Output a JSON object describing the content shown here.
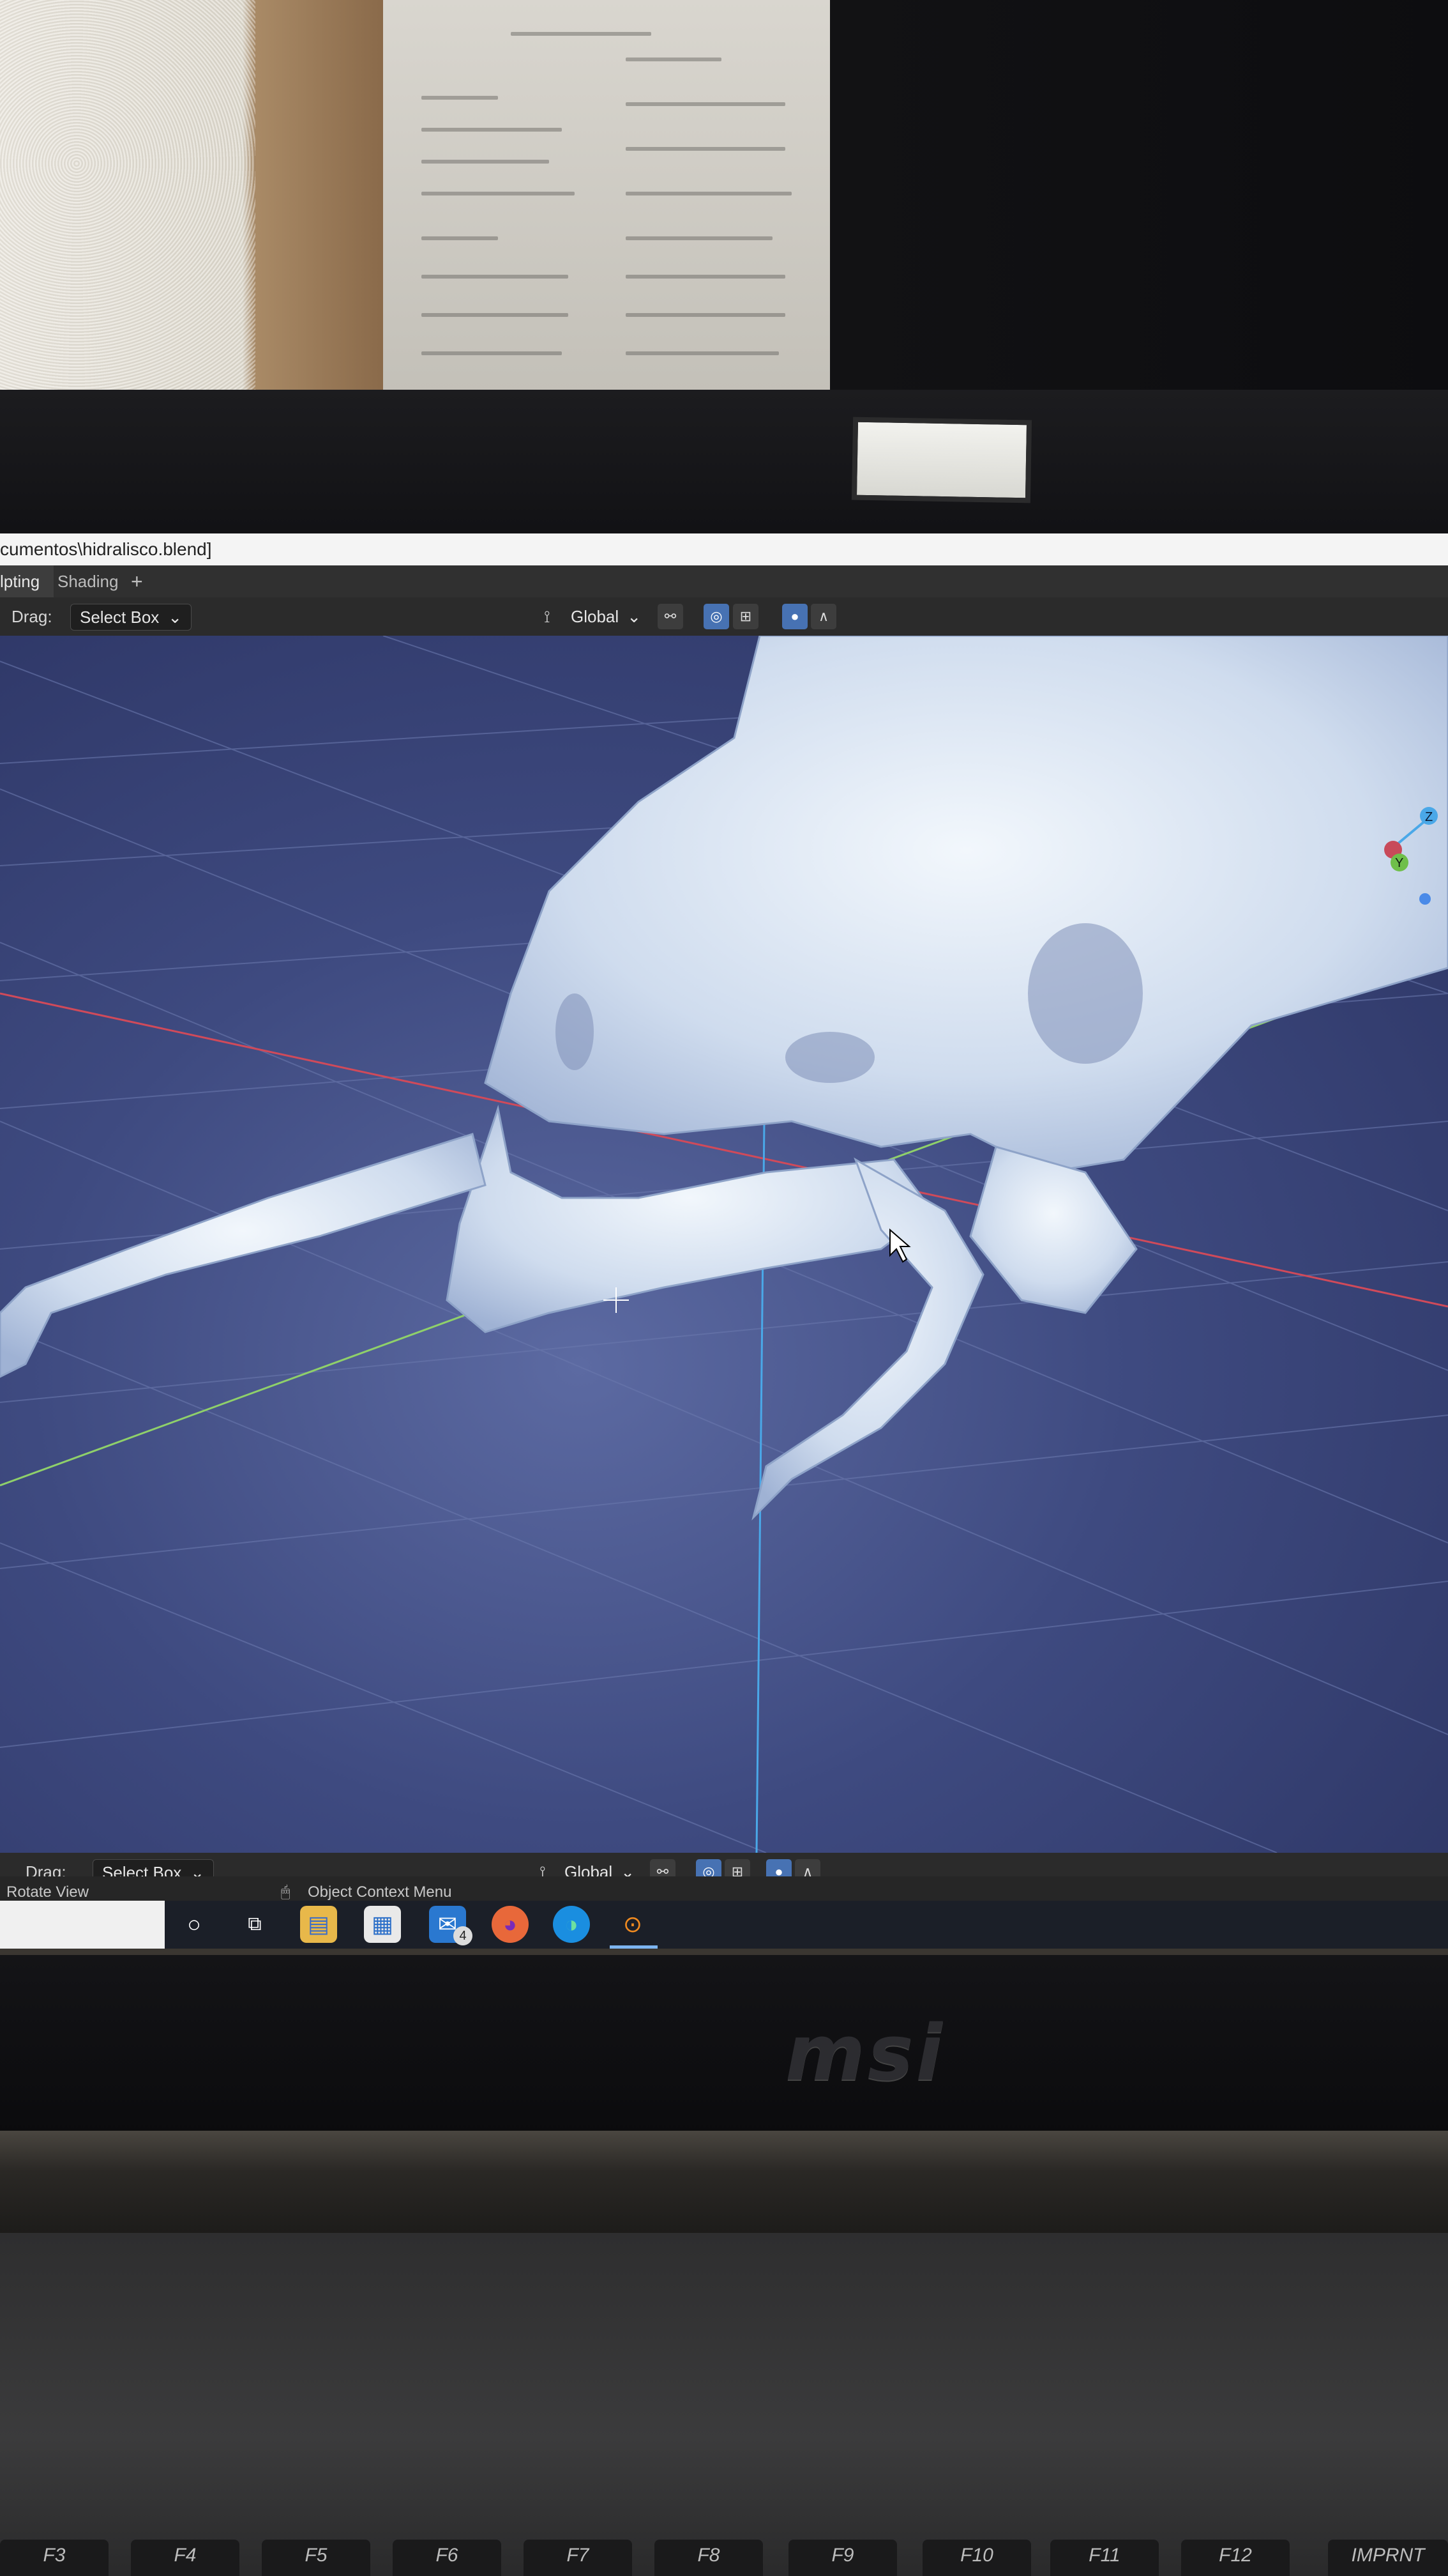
{
  "window": {
    "title": "cumentos\\hidralisco.blend]"
  },
  "workspaces": {
    "tabs": [
      {
        "label": "lpting"
      },
      {
        "label": "Shading"
      },
      {
        "label": "+"
      }
    ]
  },
  "top_toolbar": {
    "drag_label": "Drag:",
    "drag_mode": "Select Box",
    "transform_orientation": "Global"
  },
  "bottom_toolbar": {
    "drag_label": "Drag:",
    "drag_mode": "Select Box",
    "transform_orientation": "Global"
  },
  "statusbar": {
    "left_hint": "Rotate View",
    "middle_hint": "Object Context Menu"
  },
  "gizmo": {
    "z_label": "Z",
    "y_label": "Y"
  },
  "taskbar": {
    "icons": [
      {
        "name": "cortana-icon"
      },
      {
        "name": "task-view-icon"
      },
      {
        "name": "file-explorer-icon"
      },
      {
        "name": "store-icon"
      },
      {
        "name": "mail-icon",
        "badge": "4"
      },
      {
        "name": "firefox-icon"
      },
      {
        "name": "edge-icon"
      },
      {
        "name": "blender-icon"
      }
    ]
  },
  "laptop": {
    "brand": "msi",
    "function_keys": [
      "F3",
      "F4",
      "F5",
      "F6",
      "F7",
      "F8",
      "F9",
      "F10",
      "F11",
      "F12",
      "IMPRNT"
    ]
  },
  "colors": {
    "accent": "#4772b3",
    "x_axis": "#d04a5a",
    "y_axis": "#8fd06a",
    "z_axis": "#4aa8e8",
    "model": "#d8e6f4"
  }
}
